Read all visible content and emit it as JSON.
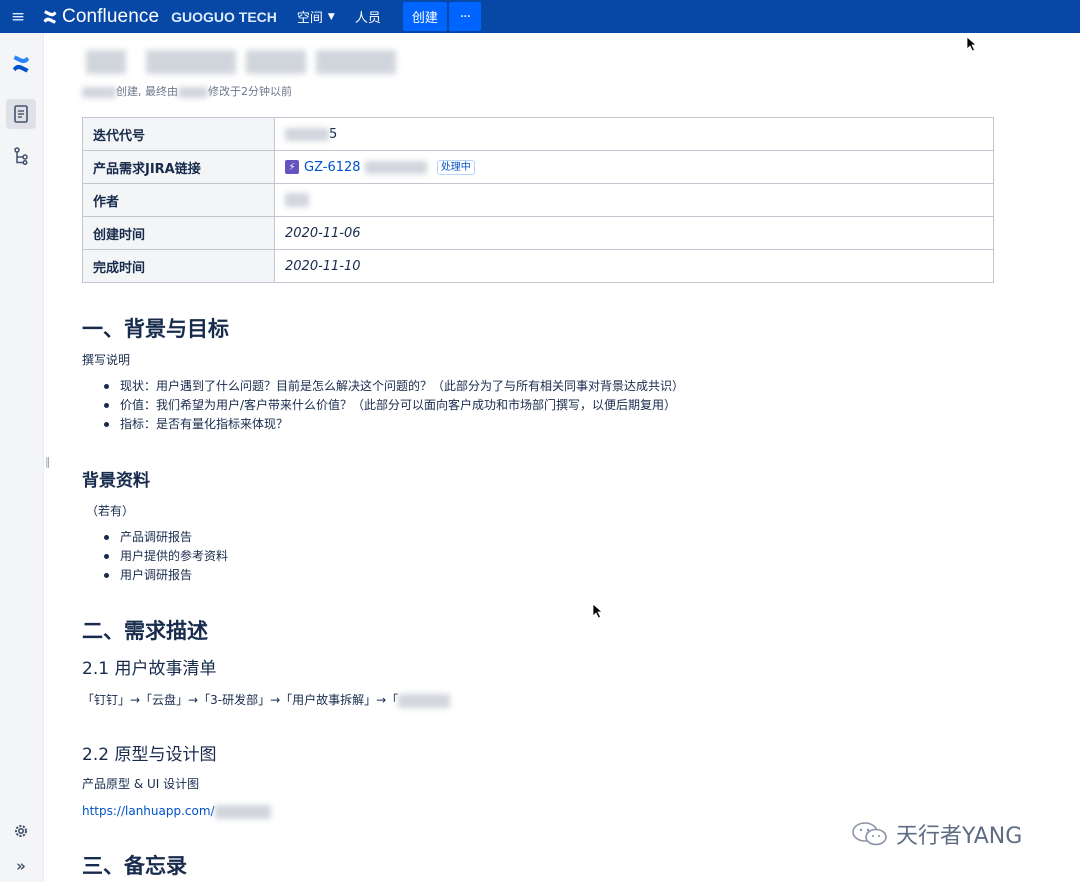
{
  "topbar": {
    "menu_icon": "hamburger-icon",
    "brand": "Confluence",
    "workspace": "GUOGUO TECH",
    "nav": [
      {
        "label": "空间",
        "has_dropdown": true
      },
      {
        "label": "人员",
        "has_dropdown": false
      }
    ],
    "create_label": "创建",
    "more_label": "···",
    "color": "#0747a6",
    "accent": "#0065ff"
  },
  "rail": {
    "icons": [
      "confluence-logo-icon",
      "pages-icon",
      "page-tree-icon",
      "settings-icon",
      "expand-icon"
    ]
  },
  "page": {
    "meta_created": "创建, 最终由",
    "meta_modified": "修改于2分钟以前",
    "info_table": [
      {
        "label": "迭代代号",
        "value": "5"
      },
      {
        "label": "产品需求JIRA链接",
        "jira_key": "GZ-6128",
        "jira_status": "处理中"
      },
      {
        "label": "作者",
        "value": ""
      },
      {
        "label": "创建时间",
        "value": "2020-11-06"
      },
      {
        "label": "完成时间",
        "value": "2020-11-10"
      }
    ],
    "sec1": {
      "title": "一、背景与目标",
      "desc": "撰写说明",
      "bullets": [
        "现状：用户遇到了什么问题？目前是怎么解决这个问题的？（此部分为了与所有相关同事对背景达成共识）",
        "价值：我们希望为用户/客户带来什么价值？（此部分可以面向客户成功和市场部门撰写，以便后期复用）",
        "指标：是否有量化指标来体现？"
      ]
    },
    "bg": {
      "title": "背景资料",
      "note": "（若有）",
      "bullets": [
        "产品调研报告",
        "用户提供的参考资料",
        "用户调研报告"
      ]
    },
    "sec2": {
      "title": "二、需求描述",
      "story_title": "2.1 用户故事清单",
      "story_path": "「钉钉」→「云盘」→「3-研发部」→「用户故事拆解」→「",
      "proto_title": "2.2 原型与设计图",
      "proto_desc": "产品原型 & UI 设计图",
      "proto_link": "https://lanhuapp.com/"
    },
    "sec3": {
      "title": "三、备忘录"
    }
  },
  "watermark": {
    "text": "天行者YANG",
    "icon": "wechat-logo-icon"
  }
}
